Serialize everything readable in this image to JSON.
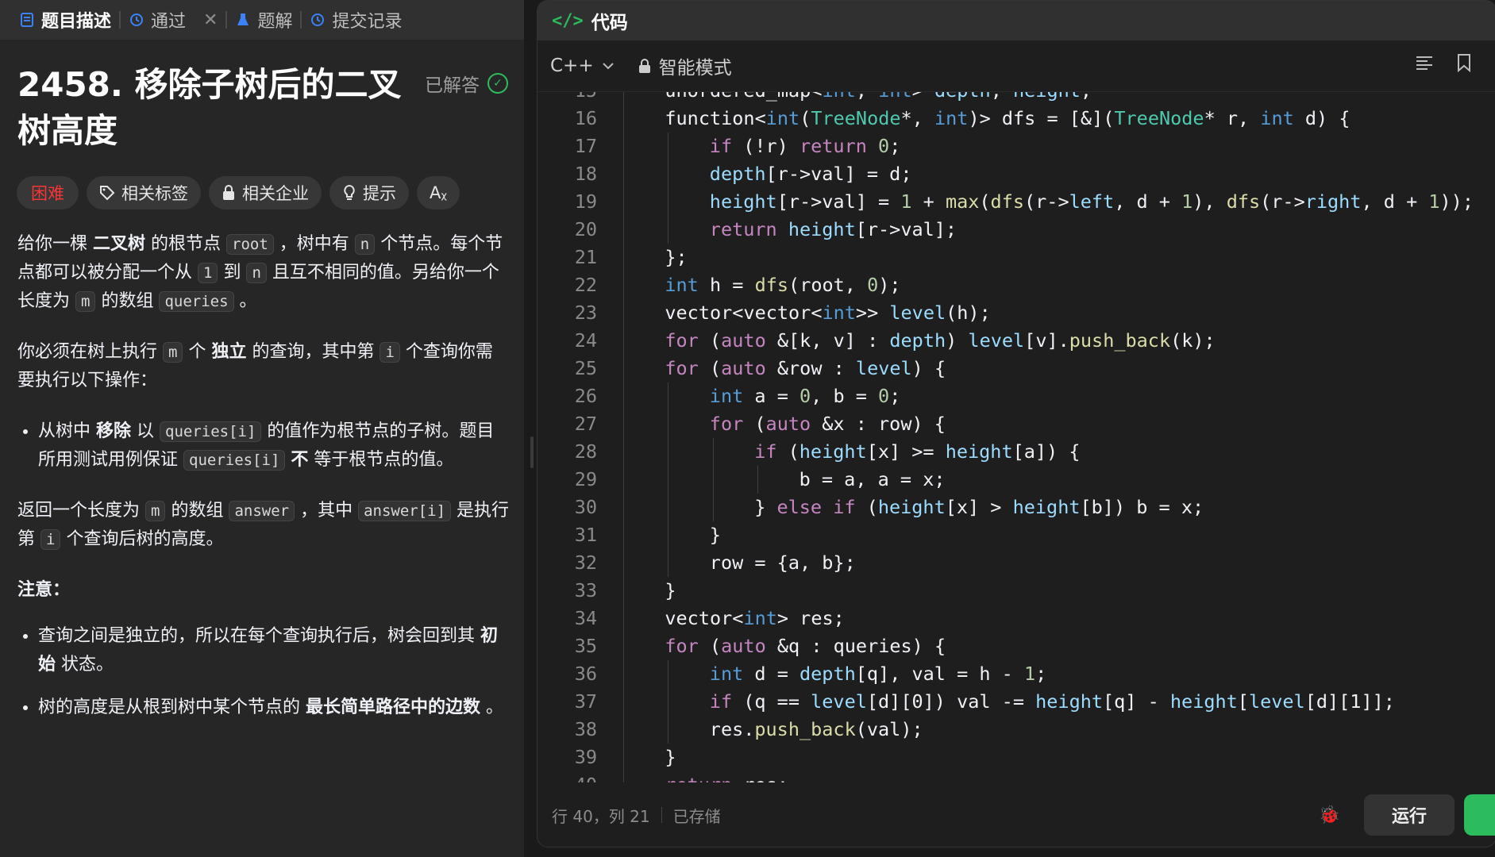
{
  "left_tabs": [
    {
      "label": "题目描述",
      "icon": "document-icon",
      "active": true
    },
    {
      "label": "通过",
      "icon": "history-icon",
      "active": false,
      "closable": true
    },
    {
      "label": "题解",
      "icon": "flask-icon",
      "active": false
    },
    {
      "label": "提交记录",
      "icon": "history-icon",
      "active": false
    }
  ],
  "problem": {
    "title": "2458. 移除子树后的二叉树高度",
    "status": "已解答",
    "chips": [
      {
        "label": "困难",
        "icon": ""
      },
      {
        "label": "相关标签",
        "icon": "tag-icon"
      },
      {
        "label": "相关企业",
        "icon": "lock-icon"
      },
      {
        "label": "提示",
        "icon": "bulb-icon"
      },
      {
        "label": "Aᵪ",
        "icon": ""
      }
    ],
    "desc": {
      "p1": {
        "a": "给你一棵 ",
        "b": "二叉树",
        "c": " 的根节点 ",
        "code1": "root",
        "d": " ，树中有 ",
        "code2": "n",
        "e": " 个节点。每个节点都可以被分配一个从 ",
        "code3": "1",
        "f": " 到 ",
        "code4": "n",
        "g": " 且互不相同的值。另给你一个长度为 ",
        "code5": "m",
        "h": " 的数组 ",
        "code6": "queries",
        "i": " 。"
      },
      "p2": {
        "a": "你必须在树上执行 ",
        "code1": "m",
        "b": " 个 ",
        "c": "独立",
        "d": " 的查询，其中第 ",
        "code2": "i",
        "e": " 个查询你需要执行以下操作："
      },
      "li1": {
        "a": "从树中 ",
        "b": "移除",
        "c": " 以 ",
        "code1": "queries[i]",
        "d": " 的值作为根节点的子树。题目所用测试用例保证 ",
        "code2": "queries[i]",
        "e": " ",
        "f": "不",
        "g": " 等于根节点的值。"
      },
      "p3": {
        "a": "返回一个长度为 ",
        "code1": "m",
        "b": " 的数组 ",
        "code2": "answer",
        "c": " ，其中 ",
        "code3": "answer[i]",
        "d": " 是执行第 ",
        "code4": "i",
        "e": " 个查询后树的高度。"
      },
      "note_title": "注意：",
      "note1": {
        "a": "查询之间是独立的，所以在每个查询执行后，树会回到其 ",
        "b": "初始",
        "c": " 状态。"
      },
      "note2": {
        "a": "树的高度是从根到树中某个节点的 ",
        "b": "最长简单路径中的边数",
        "c": " 。"
      }
    }
  },
  "code_panel": {
    "title": "代码",
    "language": "C++",
    "mode": "智能模式",
    "lines": [
      {
        "n": "15",
        "text": "unordered_map<int, int> depth, height;"
      },
      {
        "n": "16",
        "text": "function<int(TreeNode*, int)> dfs = [&](TreeNode* r, int d) {"
      },
      {
        "n": "17",
        "text": "if (!r) return 0;"
      },
      {
        "n": "18",
        "text": "depth[r->val] = d;"
      },
      {
        "n": "19",
        "text": "height[r->val] = 1 + max(dfs(r->left, d + 1), dfs(r->right, d + 1));"
      },
      {
        "n": "20",
        "text": "return height[r->val];"
      },
      {
        "n": "21",
        "text": "};"
      },
      {
        "n": "22",
        "text": "int h = dfs(root, 0);"
      },
      {
        "n": "23",
        "text": "vector<vector<int>> level(h);"
      },
      {
        "n": "24",
        "text": "for (auto &[k, v] : depth) level[v].push_back(k);"
      },
      {
        "n": "25",
        "text": "for (auto &row : level) {"
      },
      {
        "n": "26",
        "text": "int a = 0, b = 0;"
      },
      {
        "n": "27",
        "text": "for (auto &x : row) {"
      },
      {
        "n": "28",
        "text": "if (height[x] >= height[a]) {"
      },
      {
        "n": "29",
        "text": "b = a, a = x;"
      },
      {
        "n": "30",
        "text": "} else if (height[x] > height[b]) b = x;"
      },
      {
        "n": "31",
        "text": "}"
      },
      {
        "n": "32",
        "text": "row = {a, b};"
      },
      {
        "n": "33",
        "text": "}"
      },
      {
        "n": "34",
        "text": "vector<int> res;"
      },
      {
        "n": "35",
        "text": "for (auto &q : queries) {"
      },
      {
        "n": "36",
        "text": "int d = depth[q], val = h - 1;"
      },
      {
        "n": "37",
        "text": "if (q == level[d][0]) val -= height[q] - height[level[d][1]];"
      },
      {
        "n": "38",
        "text": "res.push_back(val);"
      },
      {
        "n": "39",
        "text": "}"
      },
      {
        "n": "40",
        "text": "return res;"
      }
    ],
    "status": {
      "position": "行 40，列 21",
      "saved": "已存储"
    },
    "run_label": "运行"
  }
}
